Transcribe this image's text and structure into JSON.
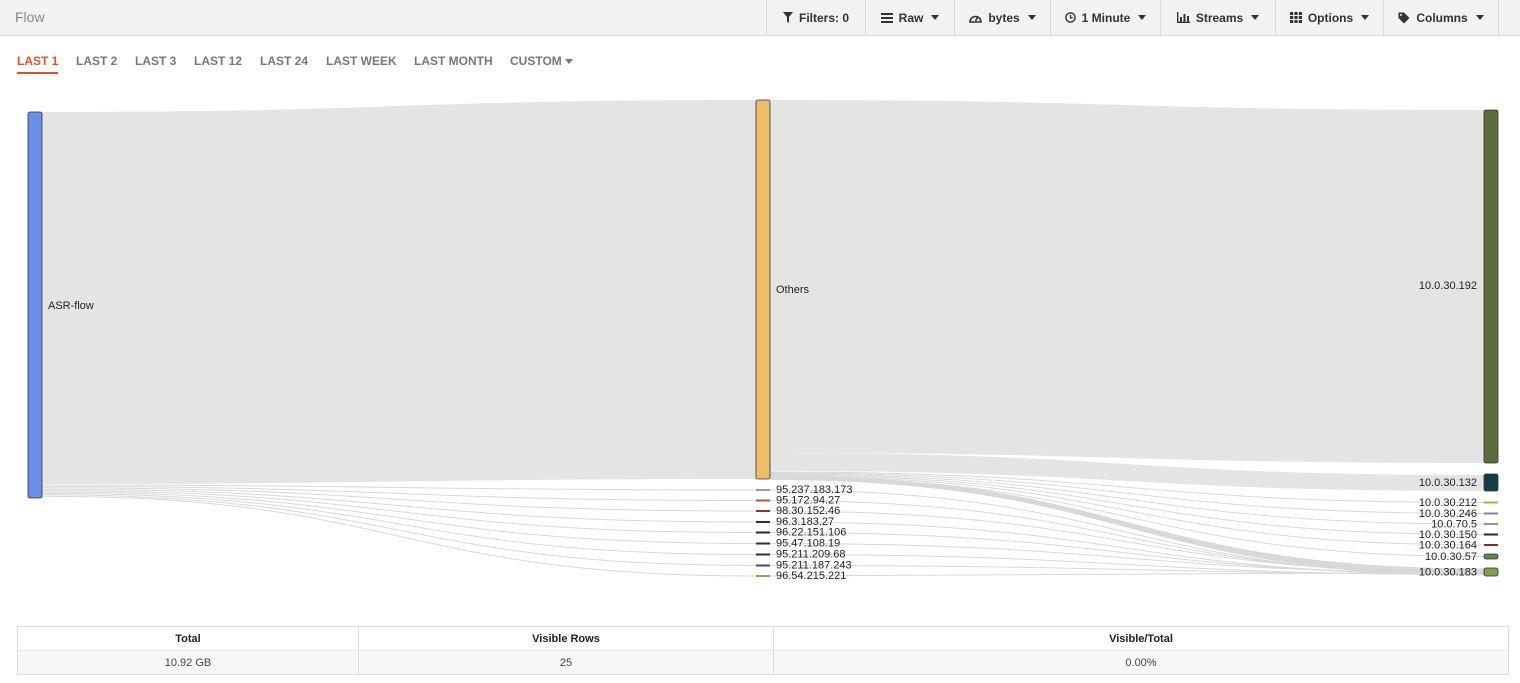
{
  "app": {
    "title": "Flow"
  },
  "toolbar": {
    "filters": "Filters: 0",
    "raw": "Raw",
    "bytes": "bytes",
    "interval": "1 Minute",
    "streams": "Streams",
    "options": "Options",
    "columns": "Columns"
  },
  "tabs": [
    "LAST 1",
    "LAST 2",
    "LAST 3",
    "LAST 12",
    "LAST 24",
    "LAST WEEK",
    "LAST MONTH",
    "CUSTOM"
  ],
  "active_tab": "LAST 1",
  "colors": {
    "accent": "#e0502f",
    "link": "#d8d8d8"
  },
  "sankey": {
    "source": {
      "name": "ASR-flow",
      "color": "#6a8fe6"
    },
    "middle": [
      {
        "name": "Others",
        "color": "#ecbd6b"
      },
      {
        "name": "95.237.183.173",
        "color": "#9a9a9a"
      },
      {
        "name": "95.172.94.27",
        "color": "#a85a4a"
      },
      {
        "name": "98.30.152.46",
        "color": "#8b3a2a"
      },
      {
        "name": "96.3.183.27",
        "color": "#2a2a5a"
      },
      {
        "name": "96.22.151.106",
        "color": "#1a2a4a"
      },
      {
        "name": "95.47.108.19",
        "color": "#3a2a3a"
      },
      {
        "name": "95.211.209.68",
        "color": "#2a2a5a"
      },
      {
        "name": "95.211.187.243",
        "color": "#3a4a9a"
      },
      {
        "name": "96.54.215.221",
        "color": "#b88a6a"
      }
    ],
    "destinations": [
      {
        "name": "10.0.30.192",
        "color": "#5b6b3a"
      },
      {
        "name": "10.0.30.132",
        "color": "#133c4a"
      },
      {
        "name": "10.0.30.212",
        "color": "#c8a640"
      },
      {
        "name": "10.0.30.246",
        "color": "#8a7ab8"
      },
      {
        "name": "10.0.70.5",
        "color": "#a88a9a"
      },
      {
        "name": "10.0.30.150",
        "color": "#2a2a2a"
      },
      {
        "name": "10.0.30.164",
        "color": "#8a2a2a"
      },
      {
        "name": "10.0.30.57",
        "color": "#5a8a4a"
      },
      {
        "name": "10.0.30.183",
        "color": "#7aa050"
      }
    ]
  },
  "summary": {
    "headers": {
      "total": "Total",
      "visible_rows": "Visible Rows",
      "ratio": "Visible/Total"
    },
    "values": {
      "total": "10.92 GB",
      "visible_rows": "25",
      "ratio": "0.00%"
    }
  }
}
